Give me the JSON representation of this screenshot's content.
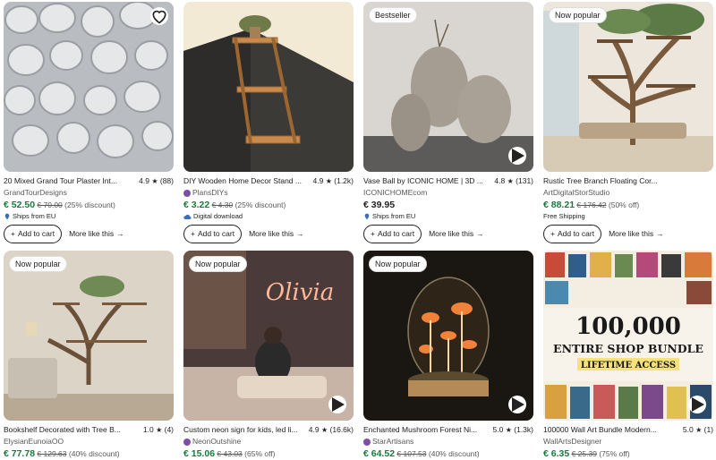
{
  "listings": [
    {
      "title": "20 Mixed Grand Tour Plaster Int...",
      "rating": "4.9",
      "reviews": "(88)",
      "shop": "GrandTourDesigns",
      "price": "€ 52.50",
      "orig": "€ 70.00",
      "disc": "(25% discount)",
      "note": "Ships from EU",
      "badge": "",
      "star_seller": false
    },
    {
      "title": "DIY Wooden Home Decor Stand ...",
      "rating": "4.9",
      "reviews": "(1.2k)",
      "shop": "PlansDIYs",
      "price": "€ 3.22",
      "orig": "€ 4.30",
      "disc": "(25% discount)",
      "note": "Digital download",
      "badge": "",
      "star_seller": true
    },
    {
      "title": "Vase Ball by ICONIC HOME | 3D ...",
      "rating": "4.8",
      "reviews": "(131)",
      "shop": "ICONICHOMEcom",
      "price": "€ 39.95",
      "orig": "",
      "disc": "",
      "note": "Ships from EU",
      "badge": "Bestseller",
      "star_seller": false
    },
    {
      "title": "Rustic Tree Branch Floating Cor...",
      "rating": "",
      "reviews": "",
      "shop": "ArtDigitalStorStudio",
      "price": "€ 88.21",
      "orig": "€ 176.42",
      "disc": "(50% off)",
      "note": "Free Shipping",
      "badge": "Now popular",
      "star_seller": false
    },
    {
      "title": "Bookshelf Decorated with Tree B...",
      "rating": "1.0",
      "reviews": "(4)",
      "shop": "ElysianEunoiaOO",
      "price": "€ 77.78",
      "orig": "€ 129.63",
      "disc": "(40% discount)",
      "note": "",
      "badge": "Now popular",
      "star_seller": false
    },
    {
      "title": "Custom neon sign for kids, led li...",
      "rating": "4.9",
      "reviews": "(16.6k)",
      "shop": "NeonOutshine",
      "price": "€ 15.06",
      "orig": "€ 43.03",
      "disc": "(65% off)",
      "note": "",
      "badge": "Now popular",
      "star_seller": true
    },
    {
      "title": "Enchanted Mushroom Forest Ni...",
      "rating": "5.0",
      "reviews": "(1.3k)",
      "shop": "StarArtisans",
      "price": "€ 64.52",
      "orig": "€ 107.53",
      "disc": "(40% discount)",
      "note": "",
      "badge": "Now popular",
      "star_seller": true
    },
    {
      "title": "100000 Wall Art Bundle Modern...",
      "rating": "5.0",
      "reviews": "(1)",
      "shop": "WallArtsDesigner",
      "price": "€ 6.35",
      "orig": "€ 25.39",
      "disc": "(75% off)",
      "note": "",
      "badge": "",
      "star_seller": false
    }
  ],
  "actions": {
    "add_to_cart": "Add to cart",
    "more_like_this": "More like this"
  },
  "bundle_art": {
    "line1": "100,000",
    "line2": "ENTIRE SHOP BUNDLE",
    "line3": "LIFETIME ACCESS"
  },
  "neon_art": {
    "text": "Olivia"
  },
  "colors": {
    "price": "#1a7a3c",
    "star_seller": "#7b4fa7"
  }
}
